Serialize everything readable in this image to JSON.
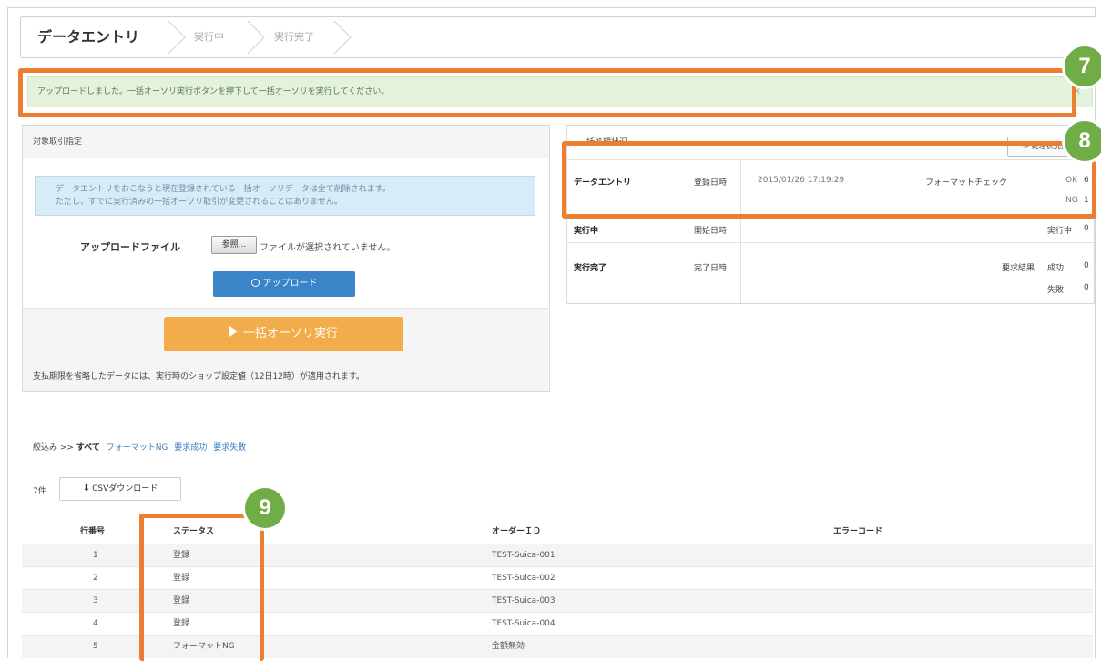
{
  "steps": [
    "データエントリ",
    "実行中",
    "実行完了"
  ],
  "alert": {
    "message": "アップロードしました。一括オーソリ実行ボタンを押下して一括オーソリを実行してください。",
    "close": "×"
  },
  "badges": {
    "b7": "7",
    "b8": "8",
    "b9": "9"
  },
  "left_panel": {
    "header": "対象取引指定",
    "info_line1": "データエントリをおこなうと現在登録されている一括オーソリデータは全て削除されます。",
    "info_line2": "ただし、すでに実行済みの一括オーソリ取引が変更されることはありません。",
    "upload_label": "アップロードファイル",
    "browse_label": "参照...",
    "no_file": "ファイルが選択されていません。",
    "upload_button": "アップロード",
    "execute_button": "一括オーソリ実行",
    "note": "支払期限を省略したデータには、実行時のショップ設定値（12日12時）が適用されます。"
  },
  "right_panel": {
    "title": "一括処理状況",
    "refresh": "処理状況更新",
    "row_entry": {
      "label": "データエントリ",
      "date_label": "登録日時",
      "date": "2015/01/26 17:19:29",
      "check_label": "フォーマットチェック",
      "ok_label": "OK",
      "ok_value": "6",
      "ng_label": "NG",
      "ng_value": "1"
    },
    "row_running": {
      "label": "実行中",
      "date_label": "開始日時",
      "status_label": "実行中",
      "value": "0"
    },
    "row_done": {
      "label": "実行完了",
      "date_label": "完了日時",
      "result_label": "要求結果",
      "success_label": "成功",
      "success_value": "0",
      "fail_label": "失敗",
      "fail_value": "0"
    }
  },
  "filter": {
    "prefix": "絞込み >> ",
    "all": "すべて",
    "links": [
      "フォーマットNG",
      "要求成功",
      "要求失敗"
    ]
  },
  "list": {
    "count": "7件",
    "csv_button": "CSVダウンロード",
    "columns": [
      "行番号",
      "ステータス",
      "オーダーＩＤ",
      "エラーコード"
    ],
    "rows": [
      {
        "no": "1",
        "status": "登録",
        "order": "TEST-Suica-001",
        "error": ""
      },
      {
        "no": "2",
        "status": "登録",
        "order": "TEST-Suica-002",
        "error": ""
      },
      {
        "no": "3",
        "status": "登録",
        "order": "TEST-Suica-003",
        "error": ""
      },
      {
        "no": "4",
        "status": "登録",
        "order": "TEST-Suica-004",
        "error": ""
      },
      {
        "no": "5",
        "status": "フォーマットNG",
        "order": "金額無効",
        "error": ""
      }
    ]
  },
  "colors": {
    "highlight": "#ed7d31",
    "badge": "#70ad47",
    "upload_button": "#3a84c8",
    "execute_button": "#f2ac4c",
    "alert_bg": "#e4f2dc",
    "info_bg": "#d8ecf7"
  }
}
